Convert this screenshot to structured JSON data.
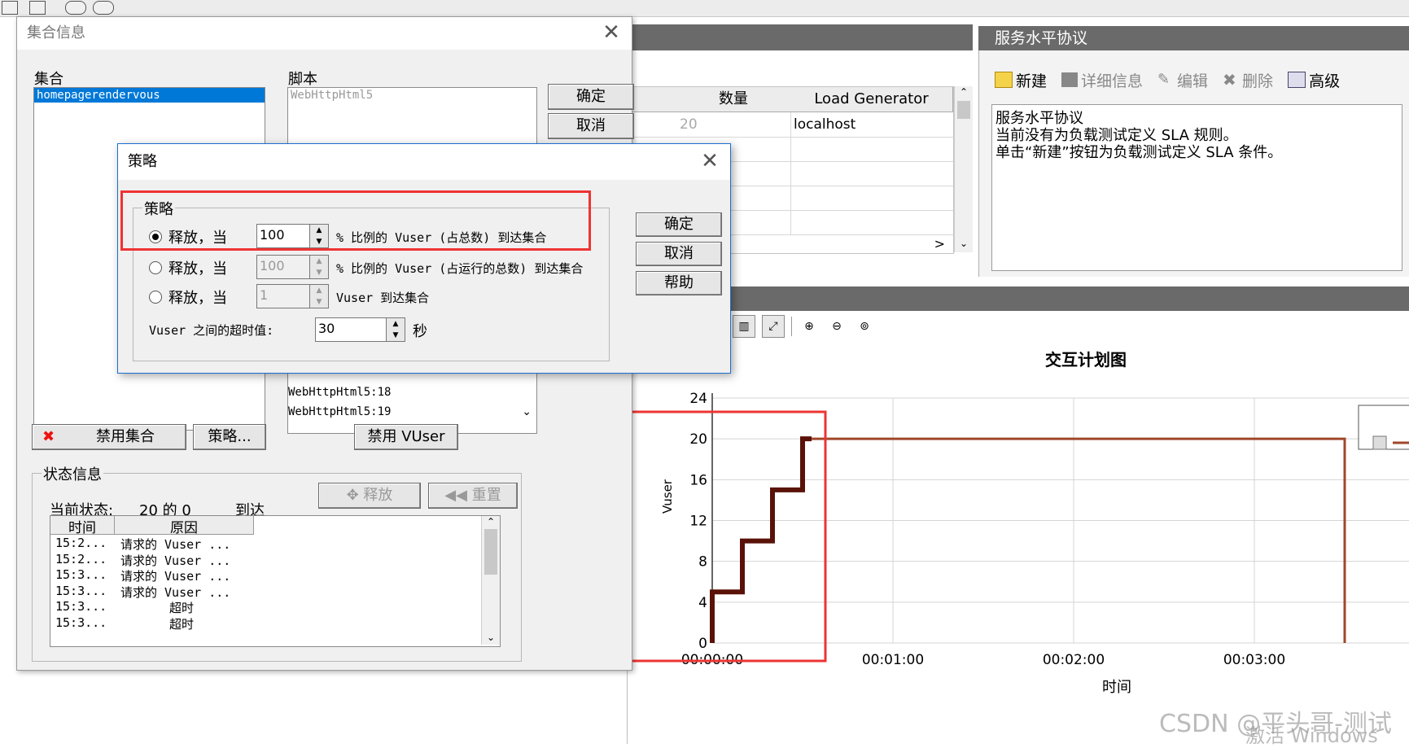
{
  "dialog_collection": {
    "title": "集合信息",
    "collection_label": "集合",
    "collection_item": "homepagerendervous",
    "script_label": "脚本",
    "script_item": "WebHttpHtml5",
    "ok": "确定",
    "cancel": "取消",
    "script_list_items": [
      "WebHttpHtml5:18",
      "WebHttpHtml5:19"
    ],
    "disable_collection": "禁用集合",
    "policy_button": "策略...",
    "disable_vuser": "禁用 VUser",
    "status_group": "状态信息",
    "current_status_label": "当前状态:",
    "current_status_value": "20 的 0",
    "arrived": "到达",
    "release_btn": "释放",
    "reset_btn": "重置",
    "log_col_time": "时间",
    "log_col_reason": "原因",
    "log_rows": [
      {
        "time": "15:2...",
        "reason": "请求的 Vuser ..."
      },
      {
        "time": "15:2...",
        "reason": "请求的 Vuser ..."
      },
      {
        "time": "15:3...",
        "reason": "请求的 Vuser ..."
      },
      {
        "time": "15:3...",
        "reason": "请求的 Vuser ..."
      },
      {
        "time": "15:3...",
        "reason": "超时"
      },
      {
        "time": "15:3...",
        "reason": "超时"
      }
    ]
  },
  "dialog_policy": {
    "title": "策略",
    "group": "策略",
    "opt1_prefix": "释放，当",
    "opt1_value": "100",
    "opt1_suffix": "% 比例的 Vuser (占总数) 到达集合",
    "opt2_prefix": "释放，当",
    "opt2_value": "100",
    "opt2_suffix": "% 比例的 Vuser (占运行的总数) 到达集合",
    "opt3_prefix": "释放，当",
    "opt3_value": "1",
    "opt3_suffix": "Vuser 到达集合",
    "timeout_label": "Vuser 之间的超时值:",
    "timeout_value": "30",
    "timeout_unit": "秒",
    "ok": "确定",
    "cancel": "取消",
    "help": "帮助"
  },
  "sla": {
    "header": "服务水平协议",
    "tools": [
      "新建",
      "详细信息",
      "编辑",
      "删除",
      "高级"
    ],
    "text_lines": [
      "服务水平协议",
      "当前没有为负载测试定义 SLA 规则。",
      "单击“新建”按钮为负载测试定义 SLA 条件。"
    ]
  },
  "lg_table": {
    "col_qty": "数量",
    "col_lg": "Load Generator",
    "row_qty": "20",
    "row_lg": "localhost"
  },
  "chart_data": {
    "type": "line",
    "title": "交互计划图",
    "xlabel": "时间",
    "ylabel": "Vuser",
    "ylim": [
      0,
      24
    ],
    "yticks": [
      "0",
      "4",
      "8",
      "12",
      "16",
      "20",
      "24"
    ],
    "xticks": [
      "00:00:00",
      "00:01:00",
      "00:02:00",
      "00:03:00"
    ],
    "x_seconds_per_tick": 60,
    "series": [
      {
        "color": "#5a1208",
        "points": [
          [
            0,
            0
          ],
          [
            0,
            5
          ],
          [
            10,
            5
          ],
          [
            10,
            10
          ],
          [
            20,
            10
          ],
          [
            20,
            15
          ],
          [
            30,
            15
          ],
          [
            30,
            20
          ],
          [
            33,
            20
          ]
        ]
      },
      {
        "color": "#a0472a",
        "points": [
          [
            33,
            20
          ],
          [
            210,
            20
          ],
          [
            210,
            0
          ]
        ]
      }
    ]
  },
  "watermark": {
    "csdn": "CSDN @平头哥-测试",
    "windows": "激活 Windows"
  }
}
